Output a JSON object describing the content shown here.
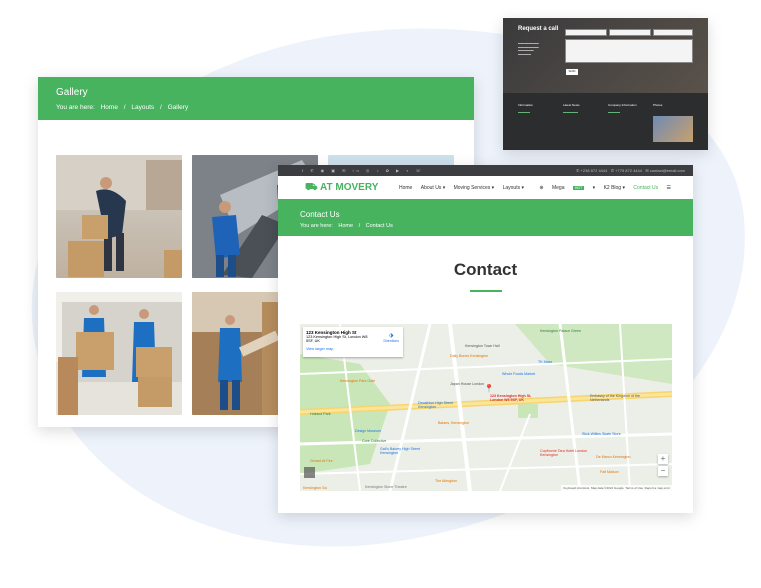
{
  "gallery_page": {
    "title": "Gallery",
    "breadcrumb": [
      "You are here:",
      "Home",
      "/",
      "Layouts",
      "/",
      "Gallery"
    ]
  },
  "request_page": {
    "title": "Request a call",
    "button": "SEND",
    "footer_cols": [
      "Information",
      "Latest News",
      "Company Information",
      "Photos"
    ]
  },
  "contact_page": {
    "phones": [
      "+238 872 4444",
      "+775 872 4444"
    ],
    "email": "contact@email.com",
    "logo_prefix": "AT",
    "logo_name": "MOVERY",
    "menu": [
      "Home",
      "About Us ▾",
      "Moving Services ▾",
      "Layouts ▾",
      "Mega",
      "HOT",
      "▾",
      "K2 Blog ▾",
      "Contact Us",
      "☰"
    ],
    "header_title": "Contact Us",
    "breadcrumb": [
      "You are here:",
      "Home",
      "/",
      "Contact Us"
    ],
    "section_title": "Contact",
    "map": {
      "place_title": "123 Kensington High St",
      "place_address": "123 Kensington High St, London W8 5SF, UK",
      "directions": "Directions",
      "larger_map": "View larger map",
      "pin_label": "123 Kensington High St, London W8 5SF, UK",
      "labels": [
        "Kensington Town Hall",
        "Daily Bones Kensington",
        "Whole Foods Market",
        "TK Maxx",
        "Japan House London",
        "Kensington Palace Green",
        "Embassy of the Kingdom of the Netherlands",
        "Kensington Park Gate",
        "Decathlon High Street Kensington",
        "Design Museum",
        "Core Collective",
        "Gail's Bakery High Street Kensington",
        "Balans, Kensington",
        "Slick Willies Skate Store",
        "Copthorne Tara Hotel London Kensington",
        "De Marco Kensington",
        "Fait Maison",
        "Gerard At Fire",
        "Holland Park",
        "The Abingdon",
        "Kensington Stone Theatre",
        "Kensington Ga"
      ],
      "footer": [
        "Keyboard shortcuts",
        "Map data ©2021 Google",
        "Terms of Use",
        "Report a map error"
      ]
    }
  },
  "colors": {
    "accent": "#47b35f",
    "dark": "#3b3d40"
  }
}
